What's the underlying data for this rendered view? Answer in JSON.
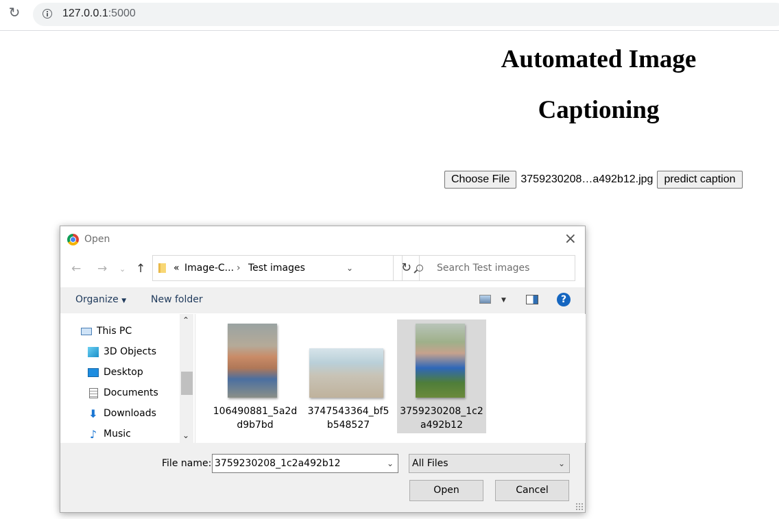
{
  "browser": {
    "url_host": "127.0.0.1",
    "url_port": ":5000"
  },
  "page": {
    "title_line1": "Automated Image",
    "title_line2": "Captioning",
    "choose_file_label": "Choose File",
    "chosen_file": "3759230208…a492b12.jpg",
    "predict_label": "predict caption"
  },
  "dialog": {
    "title": "Open",
    "path_prefix": "«",
    "path_parent": "Image-C...",
    "path_current": "Test images",
    "search_placeholder": "Search Test images",
    "toolbar": {
      "organize": "Organize",
      "new_folder": "New folder"
    },
    "sidebar": [
      {
        "label": "This PC",
        "icon": "computer-icon"
      },
      {
        "label": "3D Objects",
        "icon": "cube-icon"
      },
      {
        "label": "Desktop",
        "icon": "desktop-icon"
      },
      {
        "label": "Documents",
        "icon": "documents-icon"
      },
      {
        "label": "Downloads",
        "icon": "download-icon"
      },
      {
        "label": "Music",
        "icon": "music-icon"
      }
    ],
    "files": [
      {
        "line1": "106490881_5a2d",
        "line2": "d9b7bd",
        "selected": false
      },
      {
        "line1": "3747543364_bf5",
        "line2": "b548527",
        "selected": false
      },
      {
        "line1": "3759230208_1c2",
        "line2": "a492b12",
        "selected": true
      }
    ],
    "file_name_label": "File name:",
    "file_name_value": "3759230208_1c2a492b12",
    "file_type": "All Files",
    "open_label": "Open",
    "cancel_label": "Cancel"
  }
}
